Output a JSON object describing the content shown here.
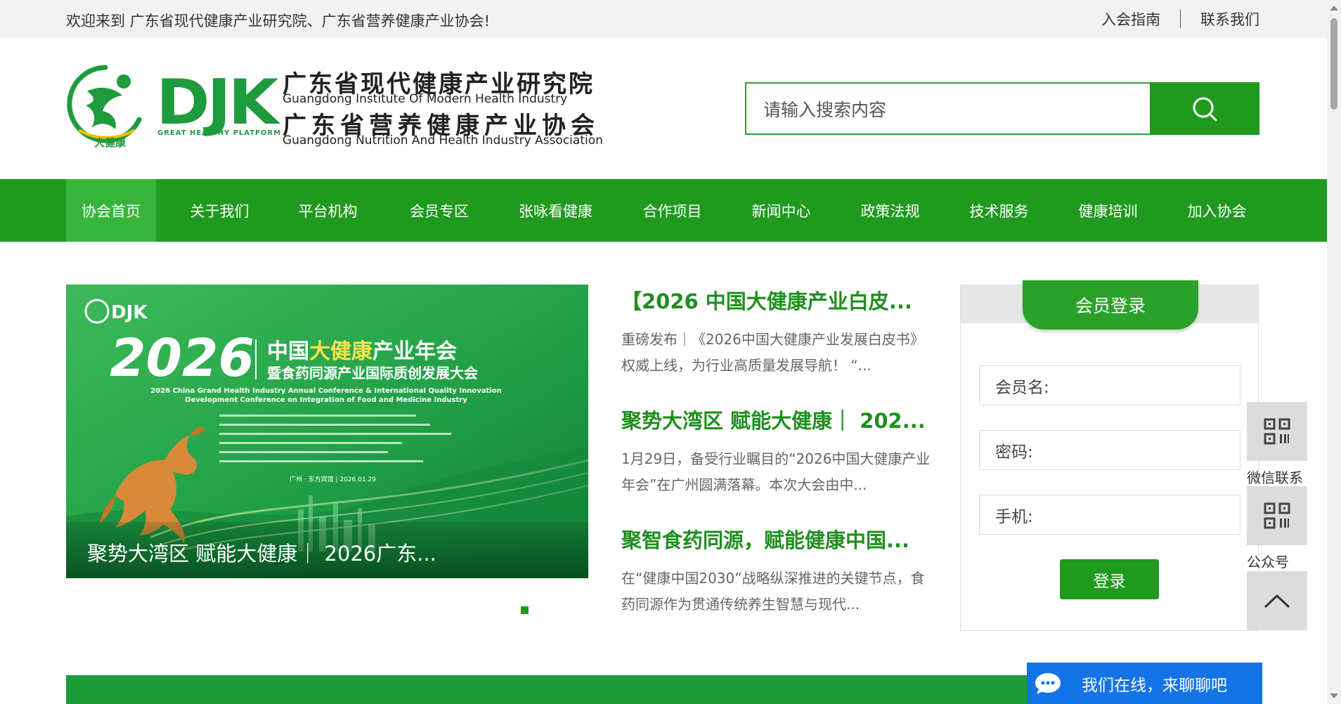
{
  "topbar": {
    "welcome": "欢迎来到 广东省现代健康产业研究院、广东省营养健康产业协会!",
    "links": [
      "入会指南",
      "联系我们"
    ]
  },
  "header": {
    "logo_mark": "大健康",
    "logo_text": "DJK",
    "logo_sub": "GREAT HEALTHY PLATFORM",
    "org_cn_1": "广东省现代健康产业研究院",
    "org_en_1": "Guangdong Institute Of Modern Health Industry",
    "org_cn_2": "广东省营养健康产业协会",
    "org_en_2": "Guangdong Nutrition And Health Industry Association"
  },
  "search": {
    "placeholder": "请输入搜索内容",
    "icon": "search-icon"
  },
  "nav": {
    "items": [
      "协会首页",
      "关于我们",
      "平台机构",
      "会员专区",
      "张咏看健康",
      "合作项目",
      "新闻中心",
      "政策法规",
      "技术服务",
      "健康培训",
      "加入协会"
    ],
    "active": 0
  },
  "banner": {
    "logo": "DJK",
    "year": "2026",
    "title_cn_a": "中国",
    "title_cn_b": "大健康",
    "title_cn_c": "产业年会",
    "subtitle_cn": "暨食药同源产业国际质创发展大会",
    "title_en": "2026 China Grand Health Industry Annual Conference & International Quality Innovation Development Conference on Integration of Food and Medicine Industry",
    "place_date": "广州 · 东方宾馆 | 2026.01.29",
    "caption": "聚势大湾区 赋能大健康｜ 2026广东..."
  },
  "news": [
    {
      "title": "【2026 中国大健康产业白皮...",
      "summary": "重磅发布｜《2026中国大健康产业发展白皮书》权威上线，为行业高质量发展导航！  “..."
    },
    {
      "title": "聚势大湾区 赋能大健康｜ 202...",
      "summary": "1月29日，备受行业瞩目的“2026中国大健康产业年会”在广州圆满落幕。本次大会由中..."
    },
    {
      "title": "聚智食药同源，赋能健康中国...",
      "summary": "在“健康中国2030”战略纵深推进的关键节点，食药同源作为贯通传统养生智慧与现代..."
    }
  ],
  "login": {
    "title": "会员登录",
    "member_label": "会员名:",
    "password_label": "密码:",
    "phone_label": "手机:",
    "submit": "登录"
  },
  "float": {
    "wechat_label": "微信联系",
    "public_label": "公众号",
    "icons": [
      "qrcode-icon",
      "qrcode-icon",
      "chevron-up-icon"
    ]
  },
  "chat": {
    "text": "我们在线，来聊聊吧",
    "icon": "chat-bubble-icon"
  },
  "colors": {
    "brand_green": "#1f9a1f",
    "nav_active": "#37b53a",
    "chat_blue": "#1473e6"
  }
}
